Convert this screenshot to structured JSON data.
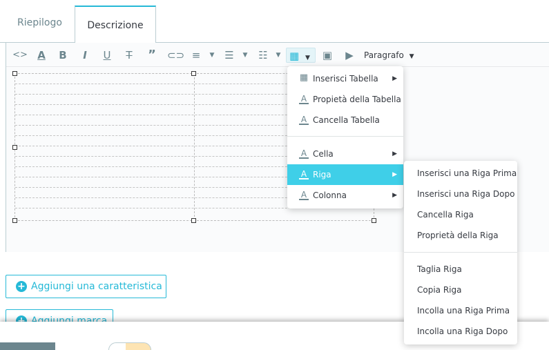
{
  "tabs": [
    {
      "label": "Riepilogo",
      "active": false
    },
    {
      "label": "Descrizione",
      "active": true
    }
  ],
  "toolbar": {
    "icons": [
      "code-icon",
      "text-color-icon",
      "bold-icon",
      "italic-icon",
      "underline-icon",
      "strikethrough-icon",
      "quote-icon",
      "link-icon",
      "align-icon",
      "bullet-list-icon",
      "numbered-list-icon",
      "table-icon",
      "image-icon",
      "media-icon"
    ],
    "format_label": "Paragrafo"
  },
  "table_menu": {
    "items": [
      {
        "label": "Inserisci Tabella",
        "icon": "table-icon",
        "has_submenu": true
      },
      {
        "label": "Propietà della Tabella",
        "icon": "format-icon",
        "has_submenu": false
      },
      {
        "label": "Cancella Tabella",
        "icon": "format-icon",
        "has_submenu": false
      },
      {
        "label": "Cella",
        "icon": "format-icon",
        "has_submenu": true
      },
      {
        "label": "Riga",
        "icon": "format-icon",
        "has_submenu": true,
        "highlighted": true
      },
      {
        "label": "Colonna",
        "icon": "format-icon",
        "has_submenu": true
      }
    ]
  },
  "row_submenu": {
    "items": [
      "Inserisci una Riga Prima",
      "Inserisci una Riga Dopo",
      "Cancella Riga",
      "Proprietà della Riga",
      "Taglia Riga",
      "Copia Riga",
      "Incolla una Riga Prima",
      "Incolla una Riga Dopo"
    ]
  },
  "buttons": {
    "add_feature": "Aggiungi una caratteristica",
    "add_brand": "Aggiungi marca"
  },
  "colors": {
    "accent": "#25b9d7",
    "highlight": "#3fcfe8",
    "border": "#bbcdd2"
  }
}
